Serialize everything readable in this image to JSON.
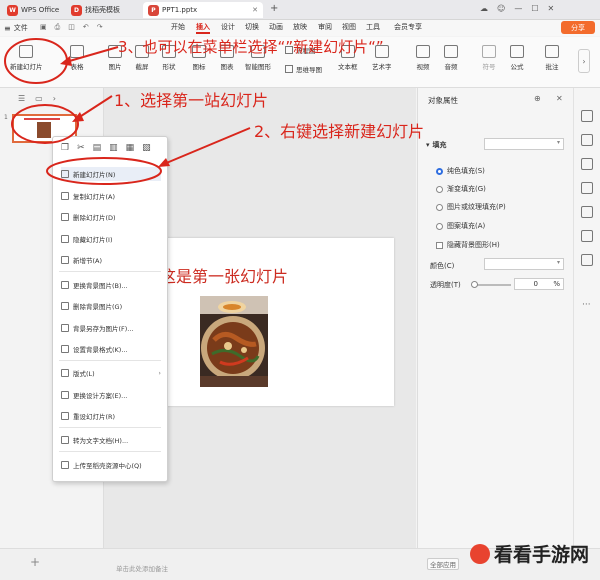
{
  "titlebar": {
    "app_tab": "WPS Office",
    "template_tab": "找稻壳模板",
    "doc_tab": "PPT1.pptx",
    "plus": "+"
  },
  "menubar": {
    "file": "文件",
    "items": [
      "开始",
      "插入",
      "设计",
      "切换",
      "动画",
      "放映",
      "审阅",
      "视图",
      "工具",
      "会员专享"
    ],
    "share": "分享"
  },
  "ribbon": {
    "new_slide": "新建幻灯片",
    "table": "表格",
    "picture": "图片",
    "screenshot": "截屏",
    "shape": "形状",
    "icon": "图标",
    "chart": "图表",
    "smartart": "智能图形",
    "flowchart": "流程图",
    "mindmap": "思维导图",
    "textbox": "文本框",
    "wordart": "艺术字",
    "video": "视频",
    "audio": "音频",
    "symbol": "符号",
    "formula": "公式",
    "crop": "批注"
  },
  "annotations": {
    "step3": "3、也可以在菜单栏选择“”新建幻灯片“”",
    "step1": "1、选择第一站幻灯片",
    "step2": "2、右键选择新建幻灯片"
  },
  "slide": {
    "title_text": "这是第一张幻灯片",
    "thumb_number": "1"
  },
  "context_menu": {
    "items": [
      "新建幻灯片(N)",
      "复制幻灯片(A)",
      "删除幻灯片(D)",
      "隐藏幻灯片(I)",
      "新增节(A)",
      "更换背景图片(B)...",
      "删除背景图片(G)",
      "背景另存为图片(F)...",
      "设置背景格式(K)...",
      "版式(L)",
      "更换设计方案(E)...",
      "重设幻灯片(R)",
      "转为文字文档(H)...",
      "上传至稻壳资源中心(Q)"
    ]
  },
  "properties": {
    "title": "对象属性",
    "dropdown": "",
    "section_fill": "填充",
    "fill_options": [
      "纯色填充(S)",
      "渐变填充(G)",
      "图片或纹理填充(P)",
      "图案填充(A)"
    ],
    "hide_bg": "隐藏背景图形(H)",
    "color_label": "颜色(C)",
    "transparency_label": "透明度(T)",
    "transparency_value": "0",
    "transparency_unit": "%"
  },
  "statusbar": {
    "notes_placeholder": "单击此处添加备注",
    "apply_all": "全部应用",
    "add": "+",
    "watermark": "看看手游网"
  },
  "colors": {
    "accent_red": "#d9261c",
    "wps_red": "#e13b2d",
    "share_orange": "#f36b2c",
    "radio_blue": "#2f6ee0"
  }
}
